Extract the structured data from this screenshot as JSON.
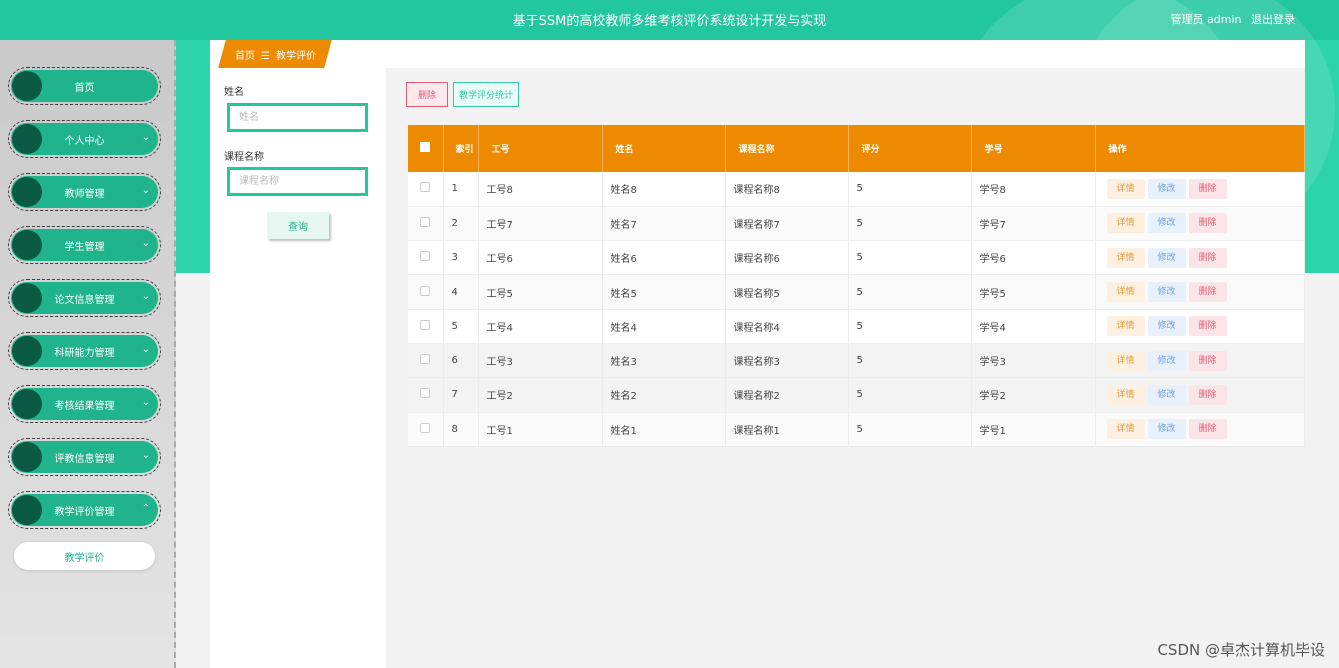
{
  "header": {
    "title": "基于SSM的高校教师多维考核评价系统设计开发与实现",
    "user_label": "管理员 admin",
    "logout_label": "退出登录"
  },
  "sidebar": {
    "items": [
      {
        "label": "首页",
        "has_chevron": false
      },
      {
        "label": "个人中心",
        "chevron": "⌄"
      },
      {
        "label": "教师管理",
        "chevron": "⌄"
      },
      {
        "label": "学生管理",
        "chevron": "⌄"
      },
      {
        "label": "论文信息管理",
        "chevron": "⌄"
      },
      {
        "label": "科研能力管理",
        "chevron": "⌄"
      },
      {
        "label": "考核结果管理",
        "chevron": "⌄"
      },
      {
        "label": "评教信息管理",
        "chevron": "⌄"
      },
      {
        "label": "教学评价管理",
        "chevron": "⌃"
      }
    ],
    "subitem": "教学评价"
  },
  "breadcrumb": {
    "home": "首页",
    "separator": "☰",
    "current": "教学评价"
  },
  "search": {
    "name_label": "姓名",
    "name_placeholder": "姓名",
    "course_label": "课程名称",
    "course_placeholder": "课程名称",
    "button": "查询"
  },
  "toolbar": {
    "delete_label": "删除",
    "stats_label": "教学评分统计"
  },
  "table": {
    "columns": [
      "索引",
      "工号",
      "姓名",
      "课程名称",
      "评分",
      "学号",
      "操作"
    ],
    "rows": [
      {
        "idx": "1",
        "job_no": "工号8",
        "name": "姓名8",
        "course": "课程名称8",
        "score": "5",
        "student_no": "学号8"
      },
      {
        "idx": "2",
        "job_no": "工号7",
        "name": "姓名7",
        "course": "课程名称7",
        "score": "5",
        "student_no": "学号7"
      },
      {
        "idx": "3",
        "job_no": "工号6",
        "name": "姓名6",
        "course": "课程名称6",
        "score": "5",
        "student_no": "学号6"
      },
      {
        "idx": "4",
        "job_no": "工号5",
        "name": "姓名5",
        "course": "课程名称5",
        "score": "5",
        "student_no": "学号5"
      },
      {
        "idx": "5",
        "job_no": "工号4",
        "name": "姓名4",
        "course": "课程名称4",
        "score": "5",
        "student_no": "学号4"
      },
      {
        "idx": "6",
        "job_no": "工号3",
        "name": "姓名3",
        "course": "课程名称3",
        "score": "5",
        "student_no": "学号3"
      },
      {
        "idx": "7",
        "job_no": "工号2",
        "name": "姓名2",
        "course": "课程名称2",
        "score": "5",
        "student_no": "学号2"
      },
      {
        "idx": "8",
        "job_no": "工号1",
        "name": "姓名1",
        "course": "课程名称1",
        "score": "5",
        "student_no": "学号1"
      }
    ],
    "actions": {
      "detail": "详情",
      "edit": "修改",
      "delete": "删除"
    }
  },
  "watermark": "CSDN @卓杰计算机毕设",
  "colors": {
    "primary": "#22c7a0",
    "table_header": "#ee8a00",
    "sidebar_pill": "#20b48c"
  }
}
